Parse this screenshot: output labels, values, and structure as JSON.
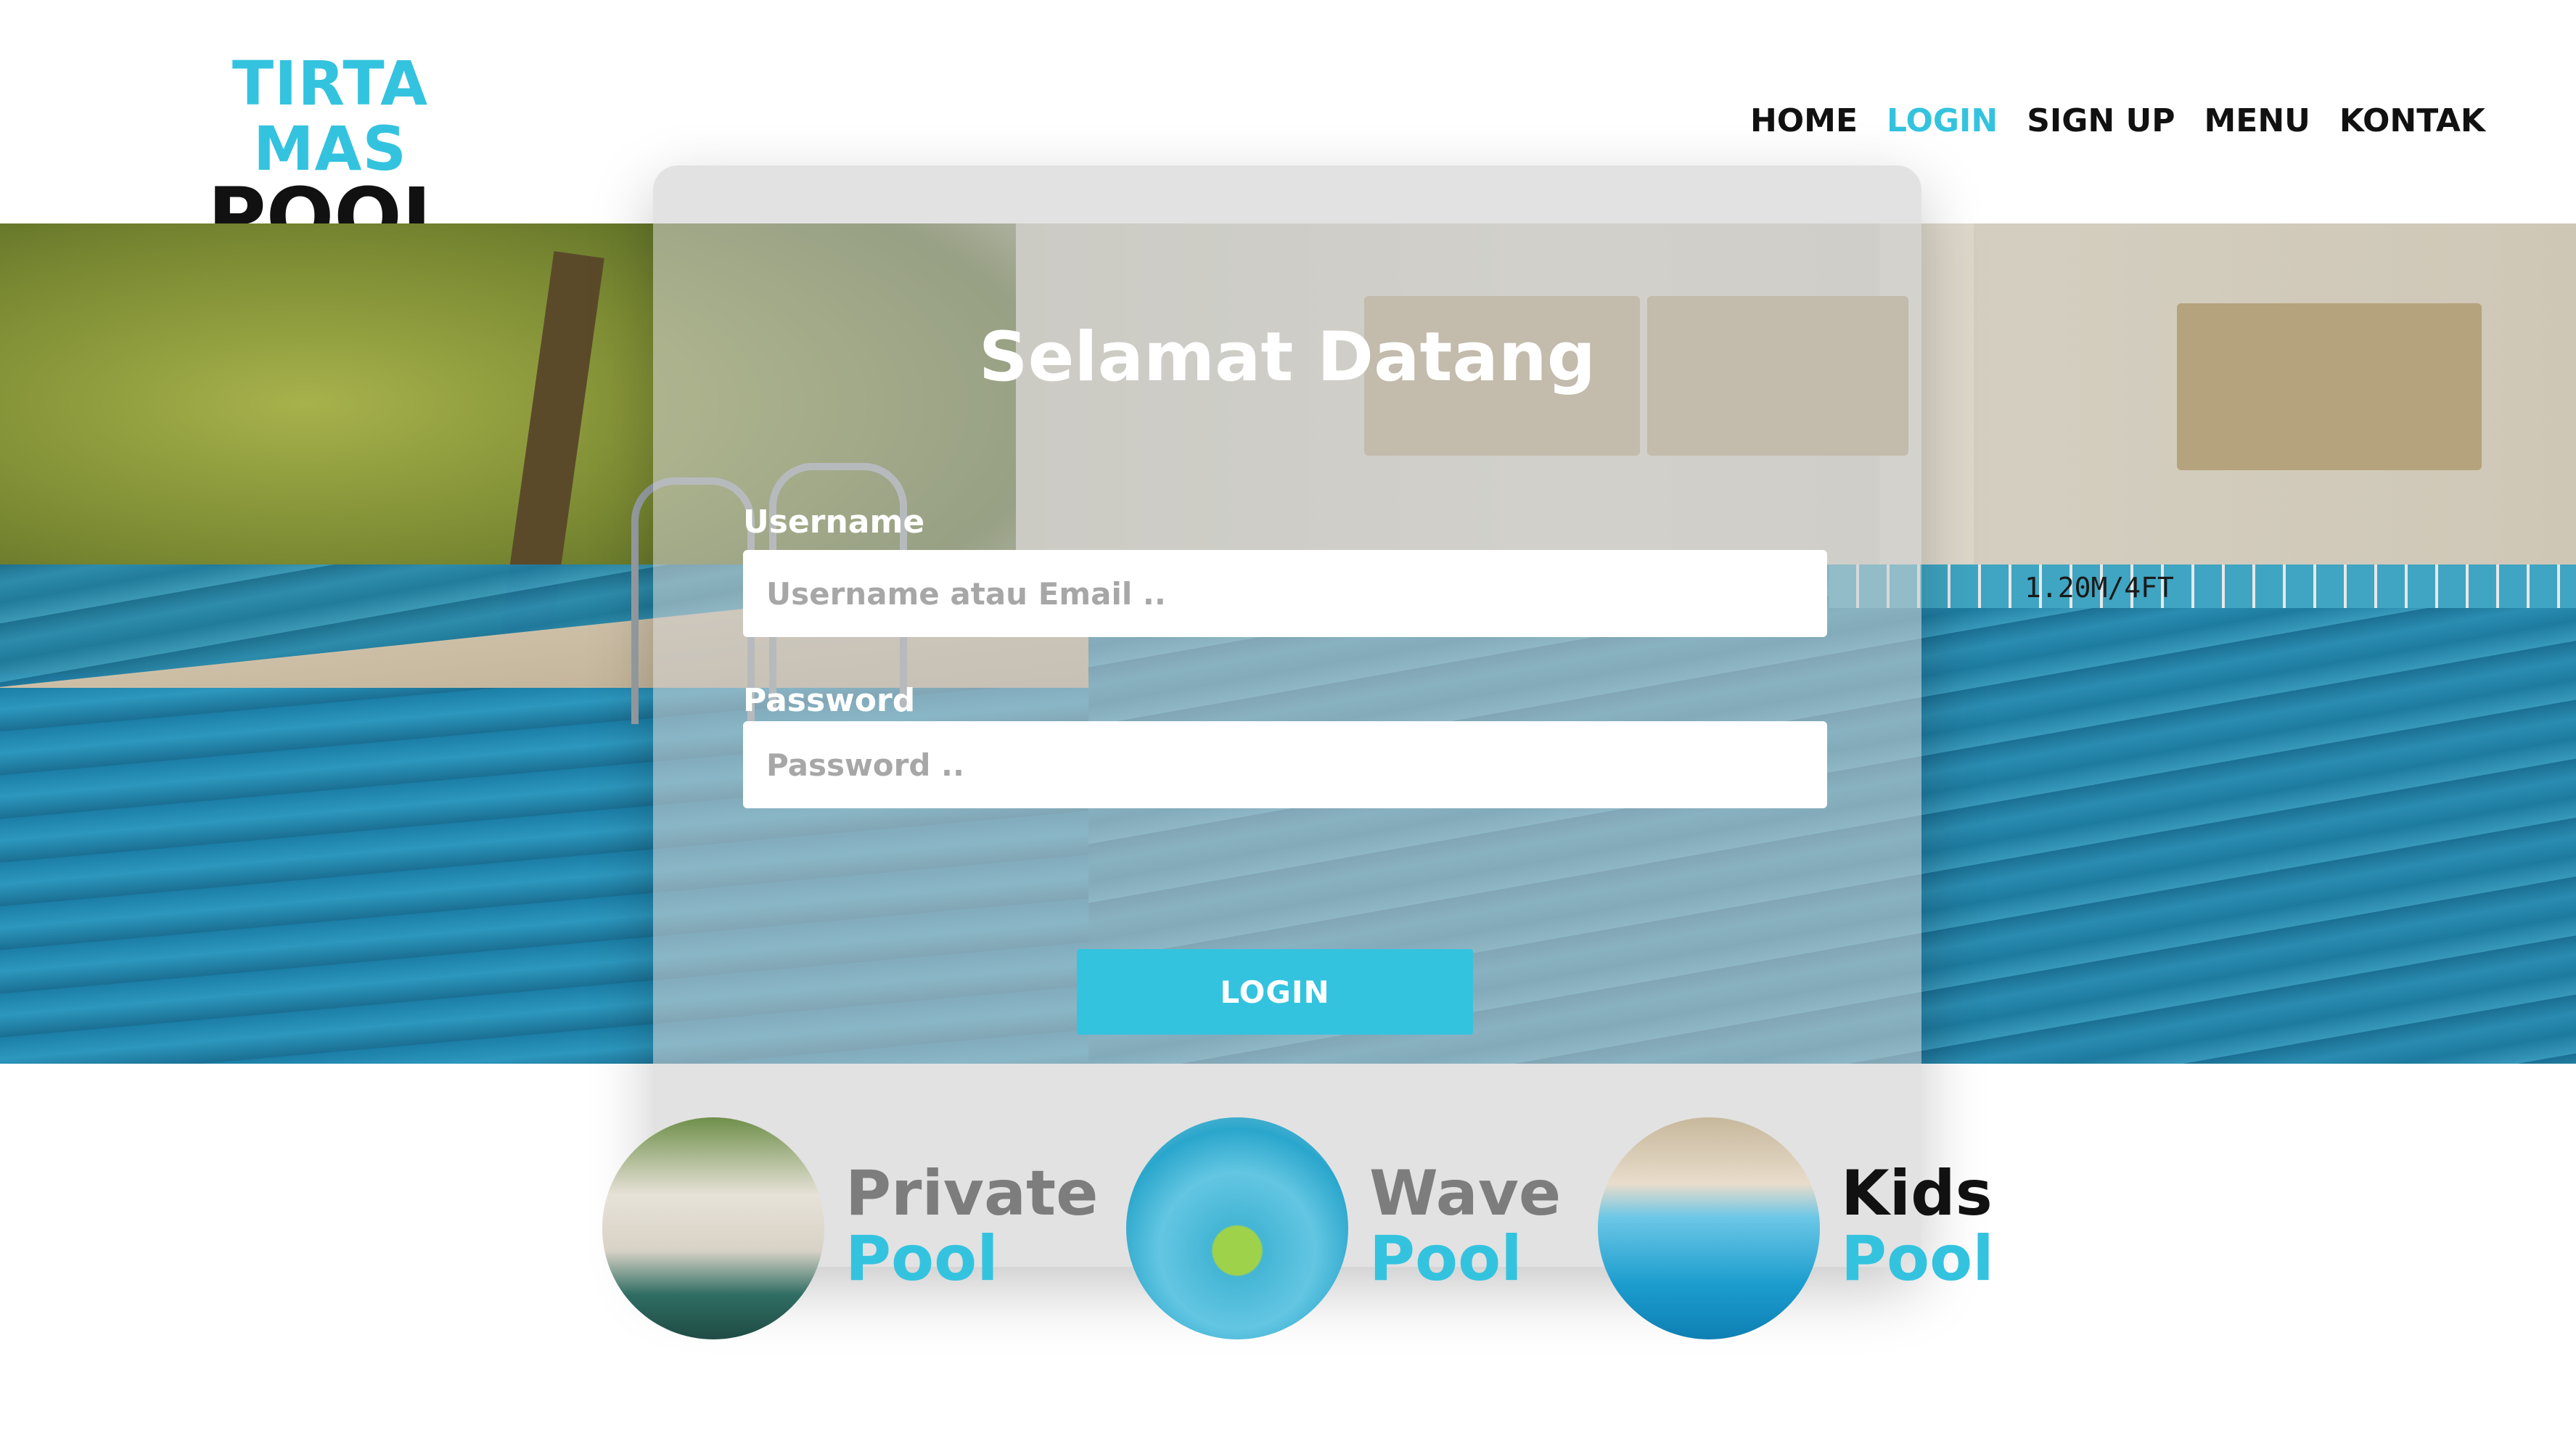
{
  "logo": {
    "top": "TIRTA MAS",
    "bottom": "POOL"
  },
  "nav": [
    {
      "label": "HOME"
    },
    {
      "label": "LOGIN",
      "active": true
    },
    {
      "label": "SIGN UP"
    },
    {
      "label": "MENU"
    },
    {
      "label": "KONTAK"
    }
  ],
  "hero": {
    "depth_sign": "1.20M/4FT"
  },
  "login": {
    "title": "Selamat Datang",
    "username_label": "Username",
    "username_placeholder": "Username atau Email ..",
    "password_label": "Password",
    "password_placeholder": "Password ..",
    "button": "LOGIN"
  },
  "pools": [
    {
      "word1": "Private",
      "word2": "Pool"
    },
    {
      "word1": "Wave",
      "word2": "Pool"
    },
    {
      "word1": "Kids",
      "word2": "Pool"
    }
  ],
  "colors": {
    "accent": "#34c3df",
    "text": "#111111",
    "muted": "#7d7d7d"
  }
}
